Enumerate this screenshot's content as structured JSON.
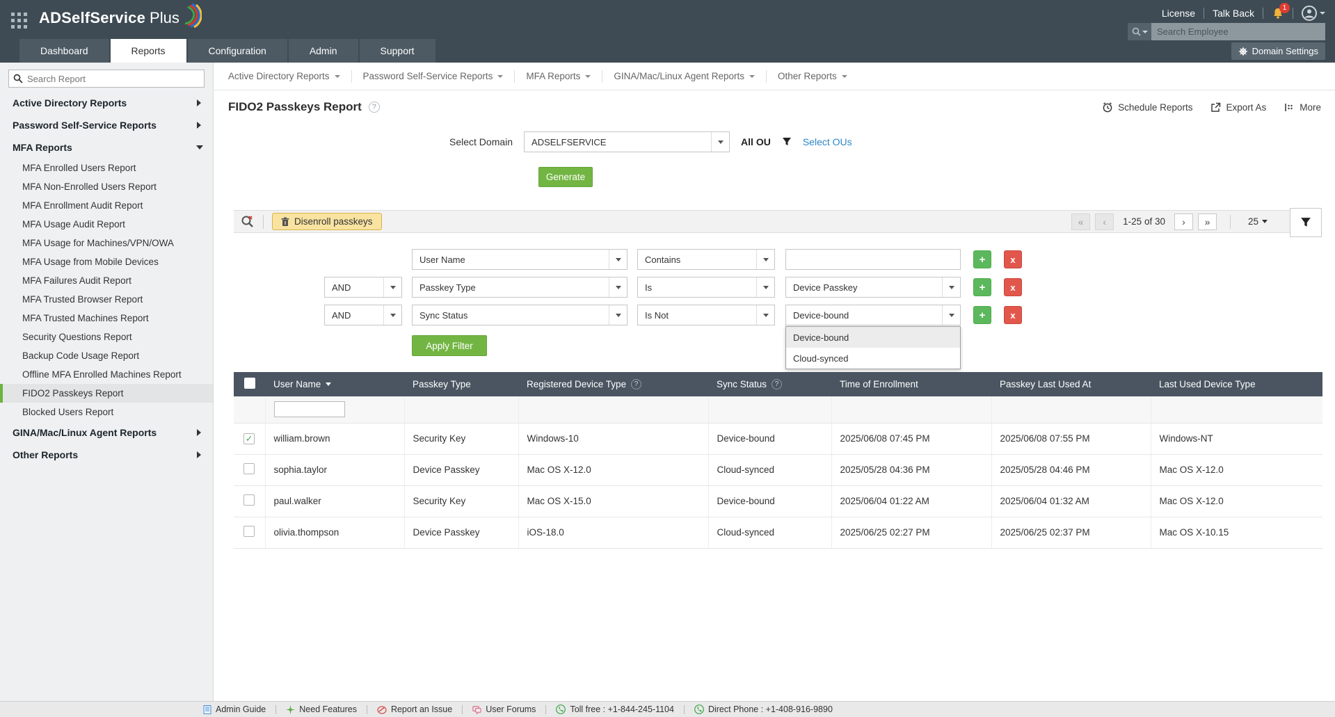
{
  "header": {
    "logo_bold": "ADSelfService",
    "logo_light": "Plus",
    "license": "License",
    "talk_back": "Talk Back",
    "notification_count": "1",
    "search_employee_placeholder": "Search Employee",
    "domain_settings": "Domain Settings"
  },
  "tabs": [
    {
      "label": "Dashboard"
    },
    {
      "label": "Reports"
    },
    {
      "label": "Configuration"
    },
    {
      "label": "Admin"
    },
    {
      "label": "Support"
    }
  ],
  "report_nav": [
    "Active Directory Reports",
    "Password Self-Service Reports",
    "MFA Reports",
    "GINA/Mac/Linux Agent Reports",
    "Other Reports"
  ],
  "sidebar": {
    "search_placeholder": "Search Report",
    "groups": [
      {
        "label": "Active Directory Reports"
      },
      {
        "label": "Password Self-Service Reports"
      },
      {
        "label": "MFA Reports"
      },
      {
        "label": "GINA/Mac/Linux Agent Reports"
      },
      {
        "label": "Other Reports"
      }
    ],
    "mfa_items": [
      "MFA Enrolled Users Report",
      "MFA Non-Enrolled Users Report",
      "MFA Enrollment Audit Report",
      "MFA Usage Audit Report",
      "MFA Usage for Machines/VPN/OWA",
      "MFA Usage from Mobile Devices",
      "MFA Failures Audit Report",
      "MFA Trusted Browser Report",
      "MFA Trusted Machines Report",
      "Security Questions Report",
      "Backup Code Usage Report",
      "Offline MFA Enrolled Machines Report",
      "FIDO2 Passkeys Report",
      "Blocked Users Report"
    ]
  },
  "page": {
    "title": "FIDO2 Passkeys Report",
    "actions": {
      "schedule": "Schedule Reports",
      "export": "Export As",
      "more": "More"
    }
  },
  "form": {
    "select_domain_label": "Select Domain",
    "domain_value": "ADSELFSERVICE",
    "all_ou_label": "All OU",
    "select_ous_label": "Select OUs",
    "generate_label": "Generate"
  },
  "toolbar": {
    "disenroll_label": "Disenroll passkeys",
    "pagination": {
      "range": "1-25 of 30",
      "page_size": "25"
    }
  },
  "filters": {
    "rows": [
      {
        "logic": "",
        "field": "User Name",
        "operator": "Contains",
        "value": ""
      },
      {
        "logic": "AND",
        "field": "Passkey Type",
        "operator": "Is",
        "value": "Device Passkey"
      },
      {
        "logic": "AND",
        "field": "Sync Status",
        "operator": "Is Not",
        "value": "Device-bound"
      }
    ],
    "dropdown": [
      "Device-bound",
      "Cloud-synced"
    ],
    "apply_label": "Apply Filter"
  },
  "table": {
    "columns": [
      "User Name",
      "Passkey Type",
      "Registered Device Type",
      "Sync Status",
      "Time of Enrollment",
      "Passkey Last Used At",
      "Last Used Device Type"
    ],
    "rows": [
      {
        "checked": true,
        "cells": [
          "william.brown",
          "Security Key",
          "Windows-10",
          "Device-bound",
          "2025/06/08 07:45 PM",
          "2025/06/08 07:55 PM",
          "Windows-NT"
        ]
      },
      {
        "checked": false,
        "cells": [
          "sophia.taylor",
          "Device Passkey",
          "Mac OS X-12.0",
          "Cloud-synced",
          "2025/05/28 04:36 PM",
          "2025/05/28 04:46 PM",
          "Mac OS X-12.0"
        ]
      },
      {
        "checked": false,
        "cells": [
          "paul.walker",
          "Security Key",
          "Mac OS X-15.0",
          "Device-bound",
          "2025/06/04 01:22 AM",
          "2025/06/04 01:32 AM",
          "Mac OS X-12.0"
        ]
      },
      {
        "checked": false,
        "cells": [
          "olivia.thompson",
          "Device Passkey",
          "iOS-18.0",
          "Cloud-synced",
          "2025/06/25 02:27 PM",
          "2025/06/25 02:37 PM",
          "Mac OS X-10.15"
        ]
      }
    ]
  },
  "footer": {
    "links": [
      "Admin Guide",
      "Need Features",
      "Report an Issue",
      "User Forums",
      "Toll free : +1-844-245-1104",
      "Direct Phone : +1-408-916-9890"
    ]
  },
  "colors": {
    "accent_green": "#72b543",
    "danger_red": "#e2574c",
    "header_bg": "#3e4b54",
    "table_header_bg": "#4a5561",
    "link_blue": "#2b87c8",
    "highlight_yellow_bg": "#f9e3a1",
    "sidebar_active_green": "#6cb33f"
  }
}
